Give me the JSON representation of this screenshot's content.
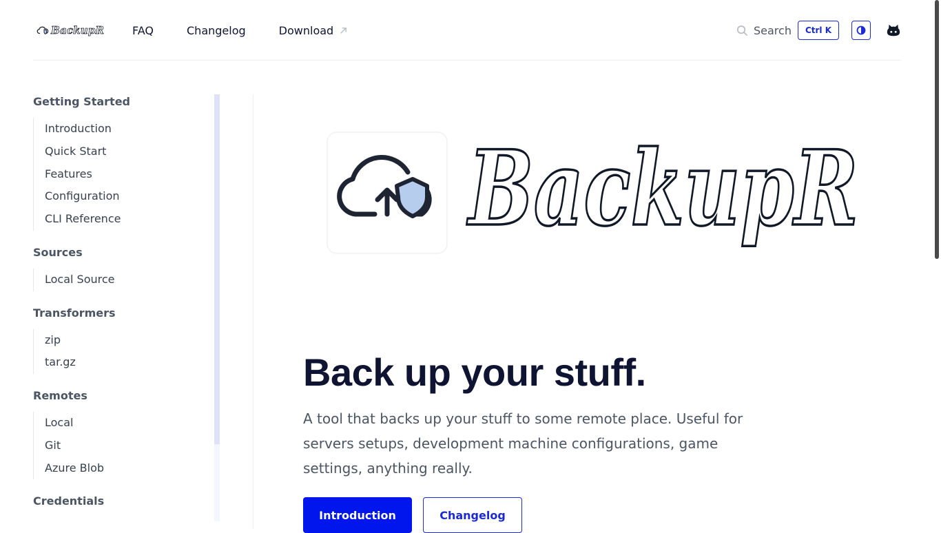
{
  "header": {
    "logo_text": "BackupR",
    "nav": [
      {
        "label": "FAQ"
      },
      {
        "label": "Changelog"
      },
      {
        "label": "Download"
      }
    ],
    "search_label": "Search",
    "search_shortcut": "Ctrl K",
    "icons": {
      "search": "search-icon",
      "external": "arrow-up-right-icon",
      "theme": "half-circle-icon",
      "github": "github-icon"
    }
  },
  "sidebar": {
    "sections": [
      {
        "title": "Getting Started",
        "items": [
          "Introduction",
          "Quick Start",
          "Features",
          "Configuration",
          "CLI Reference"
        ]
      },
      {
        "title": "Sources",
        "items": [
          "Local Source"
        ]
      },
      {
        "title": "Transformers",
        "items": [
          "zip",
          "tar.gz"
        ]
      },
      {
        "title": "Remotes",
        "items": [
          "Local",
          "Git",
          "Azure Blob"
        ]
      },
      {
        "title": "Credentials",
        "items": []
      }
    ]
  },
  "main": {
    "logo_text": "BackupR",
    "title": "Back up your stuff.",
    "description": "A tool that backs up your stuff to some remote place. Useful for servers setups, development machine configurations, game settings, anything really.",
    "primary_button": "Introduction",
    "secondary_button": "Changelog"
  },
  "colors": {
    "accent": "#1a2ad8",
    "primary_button": "#0016ec",
    "heading": "#0f1433",
    "body_text": "#4b5563",
    "shield_fill": "#b6cdee"
  }
}
